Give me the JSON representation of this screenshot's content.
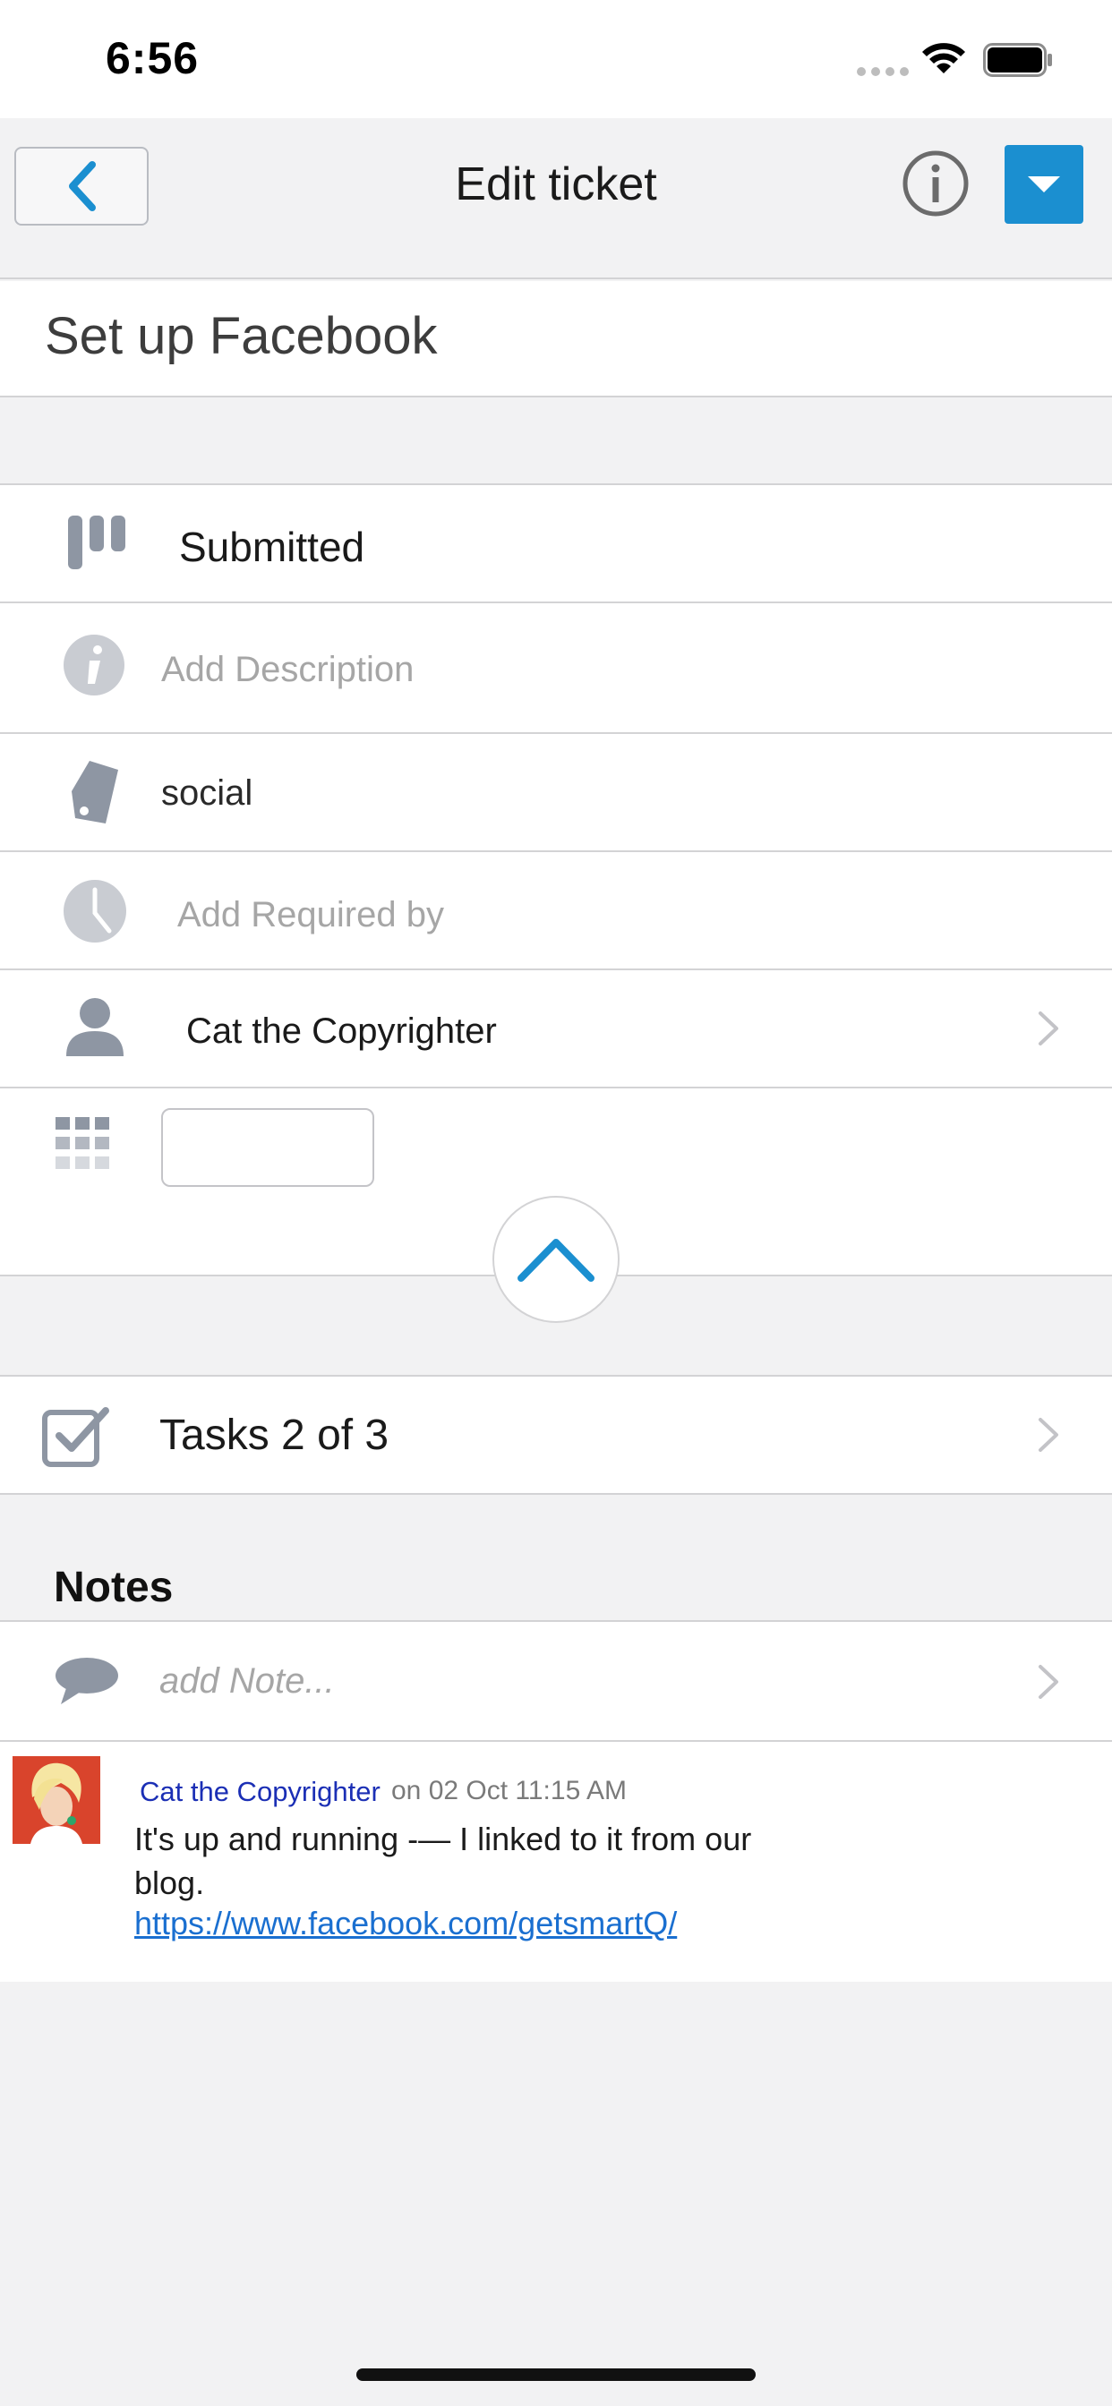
{
  "status_bar": {
    "time": "6:56"
  },
  "nav": {
    "title": "Edit ticket",
    "back_icon": "chevron-left-icon",
    "info_icon": "info-circle-icon",
    "menu_icon": "caret-down-icon"
  },
  "ticket": {
    "title": "Set up Facebook"
  },
  "fields": {
    "status": {
      "icon": "kanban-icon",
      "value": "Submitted"
    },
    "description": {
      "icon": "info-icon",
      "placeholder": "Add Description"
    },
    "tag": {
      "icon": "tag-icon",
      "value": "social"
    },
    "required_by": {
      "icon": "clock-icon",
      "placeholder": "Add Required by"
    },
    "assignee": {
      "icon": "person-icon",
      "value": "Cat the Copyrighter"
    },
    "custom": {
      "icon": "grid-icon",
      "value": ""
    }
  },
  "tasks": {
    "icon": "checkbox-icon",
    "label": "Tasks 2 of 3"
  },
  "notes": {
    "heading": "Notes",
    "add_placeholder": "add Note...",
    "items": [
      {
        "author": "Cat the Copyrighter",
        "date": "on 02 Oct 11:15 AM",
        "text": "It's up and running -— I linked to it from our blog.",
        "link": "https://www.facebook.com/getsmartQ/"
      }
    ]
  },
  "colors": {
    "accent": "#1b8fd0",
    "icon_gray": "#8e96a3",
    "placeholder_gray": "#a6a6a6",
    "background": "#f2f2f3"
  }
}
